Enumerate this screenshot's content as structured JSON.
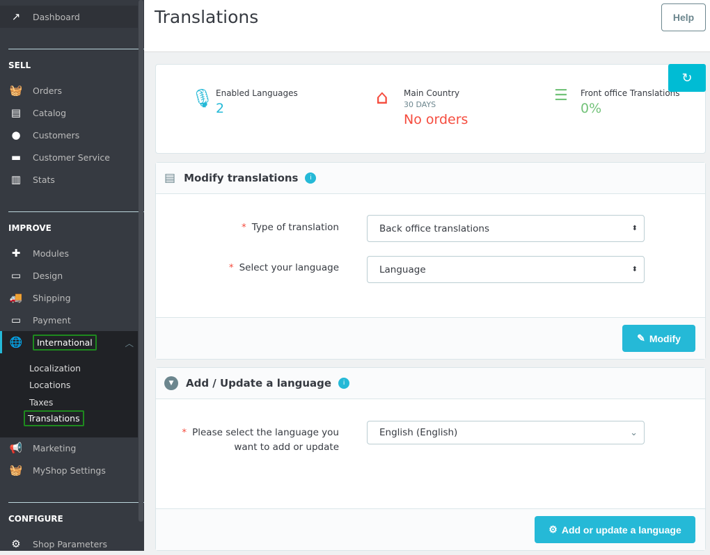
{
  "sidebar": {
    "dashboard": "Dashboard",
    "sell": "SELL",
    "sell_items": [
      "Orders",
      "Catalog",
      "Customers",
      "Customer Service",
      "Stats"
    ],
    "improve": "IMPROVE",
    "improve_items": [
      "Modules",
      "Design",
      "Shipping",
      "Payment"
    ],
    "international": "International",
    "sub_items": [
      "Localization",
      "Locations",
      "Taxes",
      "Translations"
    ],
    "after_items": [
      "Marketing",
      "MyShop Settings"
    ],
    "configure": "CONFIGURE",
    "configure_items": [
      "Shop Parameters"
    ]
  },
  "header": {
    "title": "Translations",
    "help": "Help"
  },
  "kpis": [
    {
      "label": "Enabled Languages",
      "value": "2",
      "color": "#25b9d7",
      "icon": "microphone-icon"
    },
    {
      "label": "Main Country",
      "sub": "30 DAYS",
      "value": "No orders",
      "color": "#f54c3e",
      "icon": "home-icon"
    },
    {
      "label": "Front office Translations",
      "value": "0%",
      "color": "#72c279",
      "icon": "list-icon"
    }
  ],
  "modify": {
    "title": "Modify translations",
    "type_label": "Type of translation",
    "type_value": "Back office translations",
    "lang_label": "Select your language",
    "lang_value": "Language",
    "button": "Modify"
  },
  "addupdate": {
    "title": "Add / Update a language",
    "label": "Please select the language you want to add or update",
    "value": "English (English)",
    "button": "Add or update a language"
  }
}
